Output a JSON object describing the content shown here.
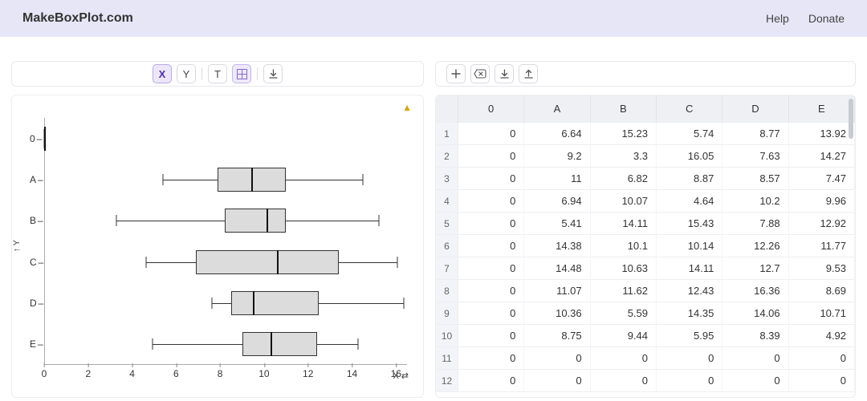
{
  "header": {
    "brand": "MakeBoxPlot.com",
    "help": "Help",
    "donate": "Donate"
  },
  "toolbar_chart": {
    "axis_x": "X",
    "axis_y": "Y",
    "text_tool": "T"
  },
  "chart": {
    "ylabel_up": "↑",
    "ylabel": "Y",
    "xlabel": "X",
    "xlabel_swap": "⇄",
    "categories": [
      "0",
      "A",
      "B",
      "C",
      "D",
      "E"
    ],
    "x_ticks": [
      0,
      2,
      4,
      6,
      8,
      10,
      12,
      14,
      16
    ],
    "x_min": 0,
    "x_max": 16.5
  },
  "chart_data": {
    "type": "boxplot",
    "orientation": "horizontal",
    "title": "",
    "xlabel": "X",
    "ylabel": "Y",
    "xlim": [
      0,
      16.5
    ],
    "categories": [
      "0",
      "A",
      "B",
      "C",
      "D",
      "E"
    ],
    "boxes": [
      {
        "name": "0",
        "min": 0,
        "q1": 0,
        "median": 0,
        "q3": 0,
        "max": 0
      },
      {
        "name": "A",
        "min": 5.41,
        "q1": 7.9,
        "median": 9.4,
        "q3": 11.0,
        "max": 14.48
      },
      {
        "name": "B",
        "min": 3.3,
        "q1": 8.2,
        "median": 10.1,
        "q3": 11.0,
        "max": 15.23
      },
      {
        "name": "C",
        "min": 4.64,
        "q1": 6.9,
        "median": 10.6,
        "q3": 13.4,
        "max": 16.05
      },
      {
        "name": "D",
        "min": 7.63,
        "q1": 8.5,
        "median": 9.5,
        "q3": 12.5,
        "max": 16.36
      },
      {
        "name": "E",
        "min": 4.92,
        "q1": 9.0,
        "median": 10.3,
        "q3": 12.4,
        "max": 14.27
      }
    ]
  },
  "table": {
    "columns": [
      "0",
      "A",
      "B",
      "C",
      "D",
      "E"
    ],
    "rows": [
      {
        "idx": "1",
        "vals": [
          "0",
          "6.64",
          "15.23",
          "5.74",
          "8.77",
          "13.92"
        ]
      },
      {
        "idx": "2",
        "vals": [
          "0",
          "9.2",
          "3.3",
          "16.05",
          "7.63",
          "14.27"
        ]
      },
      {
        "idx": "3",
        "vals": [
          "0",
          "11",
          "6.82",
          "8.87",
          "8.57",
          "7.47"
        ]
      },
      {
        "idx": "4",
        "vals": [
          "0",
          "6.94",
          "10.07",
          "4.64",
          "10.2",
          "9.96"
        ]
      },
      {
        "idx": "5",
        "vals": [
          "0",
          "5.41",
          "14.11",
          "15.43",
          "7.88",
          "12.92"
        ]
      },
      {
        "idx": "6",
        "vals": [
          "0",
          "14.38",
          "10.1",
          "10.14",
          "12.26",
          "11.77"
        ]
      },
      {
        "idx": "7",
        "vals": [
          "0",
          "14.48",
          "10.63",
          "14.11",
          "12.7",
          "9.53"
        ]
      },
      {
        "idx": "8",
        "vals": [
          "0",
          "11.07",
          "11.62",
          "12.43",
          "16.36",
          "8.69"
        ]
      },
      {
        "idx": "9",
        "vals": [
          "0",
          "10.36",
          "5.59",
          "14.35",
          "14.06",
          "10.71"
        ]
      },
      {
        "idx": "10",
        "vals": [
          "0",
          "8.75",
          "9.44",
          "5.95",
          "8.39",
          "4.92"
        ]
      },
      {
        "idx": "11",
        "vals": [
          "0",
          "0",
          "0",
          "0",
          "0",
          "0"
        ],
        "empty": true
      },
      {
        "idx": "12",
        "vals": [
          "0",
          "0",
          "0",
          "0",
          "0",
          "0"
        ],
        "empty": true
      }
    ]
  }
}
